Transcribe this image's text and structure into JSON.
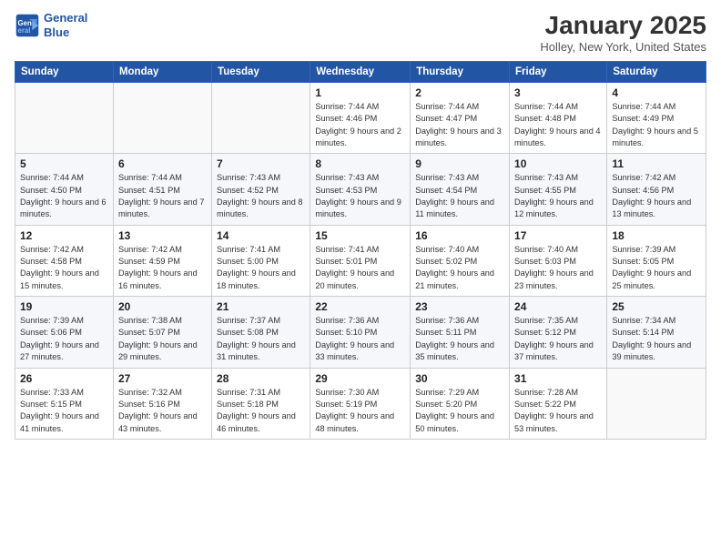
{
  "header": {
    "logo_line1": "General",
    "logo_line2": "Blue",
    "month_title": "January 2025",
    "location": "Holley, New York, United States"
  },
  "weekdays": [
    "Sunday",
    "Monday",
    "Tuesday",
    "Wednesday",
    "Thursday",
    "Friday",
    "Saturday"
  ],
  "weeks": [
    [
      {
        "day": "",
        "info": ""
      },
      {
        "day": "",
        "info": ""
      },
      {
        "day": "",
        "info": ""
      },
      {
        "day": "1",
        "info": "Sunrise: 7:44 AM\nSunset: 4:46 PM\nDaylight: 9 hours and 2 minutes."
      },
      {
        "day": "2",
        "info": "Sunrise: 7:44 AM\nSunset: 4:47 PM\nDaylight: 9 hours and 3 minutes."
      },
      {
        "day": "3",
        "info": "Sunrise: 7:44 AM\nSunset: 4:48 PM\nDaylight: 9 hours and 4 minutes."
      },
      {
        "day": "4",
        "info": "Sunrise: 7:44 AM\nSunset: 4:49 PM\nDaylight: 9 hours and 5 minutes."
      }
    ],
    [
      {
        "day": "5",
        "info": "Sunrise: 7:44 AM\nSunset: 4:50 PM\nDaylight: 9 hours and 6 minutes."
      },
      {
        "day": "6",
        "info": "Sunrise: 7:44 AM\nSunset: 4:51 PM\nDaylight: 9 hours and 7 minutes."
      },
      {
        "day": "7",
        "info": "Sunrise: 7:43 AM\nSunset: 4:52 PM\nDaylight: 9 hours and 8 minutes."
      },
      {
        "day": "8",
        "info": "Sunrise: 7:43 AM\nSunset: 4:53 PM\nDaylight: 9 hours and 9 minutes."
      },
      {
        "day": "9",
        "info": "Sunrise: 7:43 AM\nSunset: 4:54 PM\nDaylight: 9 hours and 11 minutes."
      },
      {
        "day": "10",
        "info": "Sunrise: 7:43 AM\nSunset: 4:55 PM\nDaylight: 9 hours and 12 minutes."
      },
      {
        "day": "11",
        "info": "Sunrise: 7:42 AM\nSunset: 4:56 PM\nDaylight: 9 hours and 13 minutes."
      }
    ],
    [
      {
        "day": "12",
        "info": "Sunrise: 7:42 AM\nSunset: 4:58 PM\nDaylight: 9 hours and 15 minutes."
      },
      {
        "day": "13",
        "info": "Sunrise: 7:42 AM\nSunset: 4:59 PM\nDaylight: 9 hours and 16 minutes."
      },
      {
        "day": "14",
        "info": "Sunrise: 7:41 AM\nSunset: 5:00 PM\nDaylight: 9 hours and 18 minutes."
      },
      {
        "day": "15",
        "info": "Sunrise: 7:41 AM\nSunset: 5:01 PM\nDaylight: 9 hours and 20 minutes."
      },
      {
        "day": "16",
        "info": "Sunrise: 7:40 AM\nSunset: 5:02 PM\nDaylight: 9 hours and 21 minutes."
      },
      {
        "day": "17",
        "info": "Sunrise: 7:40 AM\nSunset: 5:03 PM\nDaylight: 9 hours and 23 minutes."
      },
      {
        "day": "18",
        "info": "Sunrise: 7:39 AM\nSunset: 5:05 PM\nDaylight: 9 hours and 25 minutes."
      }
    ],
    [
      {
        "day": "19",
        "info": "Sunrise: 7:39 AM\nSunset: 5:06 PM\nDaylight: 9 hours and 27 minutes."
      },
      {
        "day": "20",
        "info": "Sunrise: 7:38 AM\nSunset: 5:07 PM\nDaylight: 9 hours and 29 minutes."
      },
      {
        "day": "21",
        "info": "Sunrise: 7:37 AM\nSunset: 5:08 PM\nDaylight: 9 hours and 31 minutes."
      },
      {
        "day": "22",
        "info": "Sunrise: 7:36 AM\nSunset: 5:10 PM\nDaylight: 9 hours and 33 minutes."
      },
      {
        "day": "23",
        "info": "Sunrise: 7:36 AM\nSunset: 5:11 PM\nDaylight: 9 hours and 35 minutes."
      },
      {
        "day": "24",
        "info": "Sunrise: 7:35 AM\nSunset: 5:12 PM\nDaylight: 9 hours and 37 minutes."
      },
      {
        "day": "25",
        "info": "Sunrise: 7:34 AM\nSunset: 5:14 PM\nDaylight: 9 hours and 39 minutes."
      }
    ],
    [
      {
        "day": "26",
        "info": "Sunrise: 7:33 AM\nSunset: 5:15 PM\nDaylight: 9 hours and 41 minutes."
      },
      {
        "day": "27",
        "info": "Sunrise: 7:32 AM\nSunset: 5:16 PM\nDaylight: 9 hours and 43 minutes."
      },
      {
        "day": "28",
        "info": "Sunrise: 7:31 AM\nSunset: 5:18 PM\nDaylight: 9 hours and 46 minutes."
      },
      {
        "day": "29",
        "info": "Sunrise: 7:30 AM\nSunset: 5:19 PM\nDaylight: 9 hours and 48 minutes."
      },
      {
        "day": "30",
        "info": "Sunrise: 7:29 AM\nSunset: 5:20 PM\nDaylight: 9 hours and 50 minutes."
      },
      {
        "day": "31",
        "info": "Sunrise: 7:28 AM\nSunset: 5:22 PM\nDaylight: 9 hours and 53 minutes."
      },
      {
        "day": "",
        "info": ""
      }
    ]
  ]
}
